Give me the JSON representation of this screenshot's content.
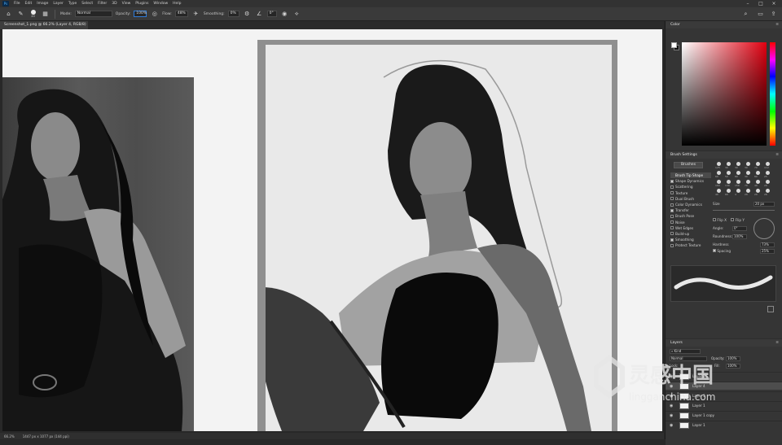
{
  "menubar": {
    "items": [
      "File",
      "Edit",
      "Image",
      "Layer",
      "Type",
      "Select",
      "Filter",
      "3D",
      "View",
      "Plugins",
      "Window",
      "Help"
    ]
  },
  "options_bar": {
    "brush_size": "20",
    "mode_label": "Mode:",
    "mode_value": "Normal",
    "opacity_label": "Opacity:",
    "opacity_value": "100%",
    "flow_label": "Flow:",
    "flow_value": "48%",
    "smoothing_label": "Smoothing:",
    "smoothing_value": "0%",
    "angle_value": "0°"
  },
  "document": {
    "tab_title": "Screenshot_1.png @ 66.2% (Layer 4, RGB/8) *"
  },
  "status": {
    "zoom": "66.2%",
    "doc_size": "1447 px x 1077 px (144 ppi)"
  },
  "color_panel": {
    "title": "Color",
    "fg": "#ffffff",
    "bg": "#111111",
    "accent": "#e10010"
  },
  "brush_settings": {
    "title": "Brush Settings",
    "brushes_button": "Brushes",
    "options": [
      {
        "label": "Brush Tip Shape",
        "checked": false,
        "selected": true
      },
      {
        "label": "Shape Dynamics",
        "checked": true,
        "selected": false
      },
      {
        "label": "Scattering",
        "checked": false,
        "selected": false
      },
      {
        "label": "Texture",
        "checked": false,
        "selected": false
      },
      {
        "label": "Dual Brush",
        "checked": false,
        "selected": false
      },
      {
        "label": "Color Dynamics",
        "checked": false,
        "selected": false
      },
      {
        "label": "Transfer",
        "checked": true,
        "selected": false
      },
      {
        "label": "Brush Pose",
        "checked": false,
        "selected": false
      },
      {
        "label": "Noise",
        "checked": false,
        "selected": false
      },
      {
        "label": "Wet Edges",
        "checked": false,
        "selected": false
      },
      {
        "label": "Build-up",
        "checked": false,
        "selected": false
      },
      {
        "label": "Smoothing",
        "checked": true,
        "selected": false
      },
      {
        "label": "Protect Texture",
        "checked": false,
        "selected": false
      }
    ],
    "tips": [
      "125",
      "30",
      "30",
      "30",
      "70",
      "112",
      "60",
      "50",
      "80",
      "30",
      "80",
      "25",
      "160",
      "140",
      "150",
      "70",
      "40",
      "20",
      "40",
      "60",
      "4",
      "20",
      "20",
      "26"
    ],
    "size_label": "Size",
    "size_value": "20 px",
    "flip_x": "Flip X",
    "flip_y": "Flip Y",
    "angle_label": "Angle:",
    "angle_value": "0°",
    "roundness_label": "Roundness:",
    "roundness_value": "100%",
    "hardness_label": "Hardness",
    "hardness_value": "73%",
    "spacing_label": "Spacing",
    "spacing_value": "25%"
  },
  "layers_panel": {
    "title": "Layers",
    "kind_filter": "Kind",
    "blend_mode": "Normal",
    "opacity_label": "Opacity:",
    "opacity_value": "100%",
    "lock_label": "Lock:",
    "fill_label": "Fill:",
    "fill_value": "100%",
    "layers": [
      {
        "name": "Layer 2",
        "selected": false
      },
      {
        "name": "Layer 4",
        "selected": true
      },
      {
        "name": "Layer 3",
        "selected": false
      },
      {
        "name": "Layer 1",
        "selected": false
      },
      {
        "name": "Layer 1 copy",
        "selected": false
      },
      {
        "name": "Layer 1",
        "selected": false
      }
    ]
  },
  "watermark": {
    "brand_cn": "灵感中国",
    "url": "lingganchina.com"
  }
}
